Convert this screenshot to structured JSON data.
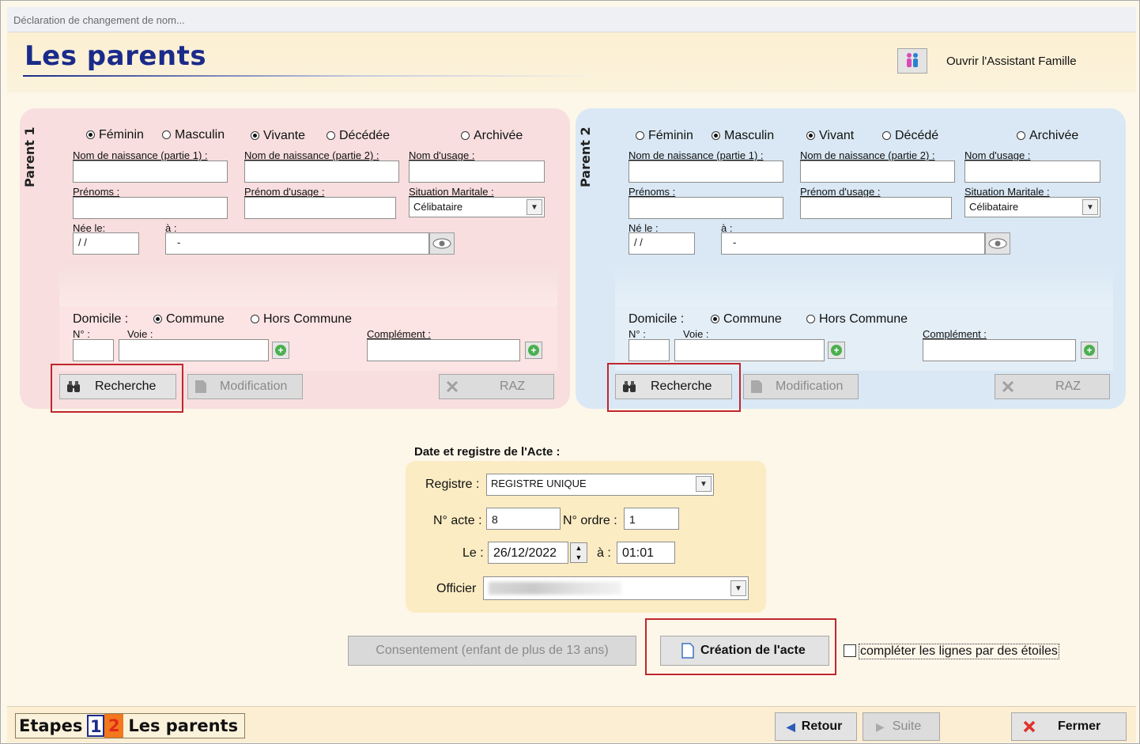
{
  "window": {
    "title": "Déclaration de changement de nom..."
  },
  "header": {
    "title": "Les parents",
    "assistant_label": "Ouvrir l'Assistant Famille"
  },
  "parent1": {
    "tab": "Parent 1",
    "sex": {
      "feminin": "Féminin",
      "masculin": "Masculin",
      "selected": "Féminin"
    },
    "status": {
      "vivant": "Vivante",
      "decede": "Décédée",
      "selected": "Vivante"
    },
    "archive": "Archivée",
    "labels": {
      "nom1": "Nom de naissance (partie 1) :",
      "nom2": "Nom de naissance (partie 2) :",
      "usage": "Nom d'usage :",
      "prenoms": "Prénoms :",
      "prenom_usage": "Prénom d'usage :",
      "situation": "Situation Maritale :",
      "ne_le": "Née le:",
      "a": "à :"
    },
    "values": {
      "situation": "Célibataire",
      "date": " / /",
      "lieu": "-"
    },
    "domicile": {
      "label": "Domicile :",
      "commune": "Commune",
      "hors": "Hors Commune",
      "selected": "Commune",
      "num": "N° :",
      "voie": "Voie :",
      "complement": "Complément :"
    },
    "buttons": {
      "recherche": "Recherche",
      "modification": "Modification",
      "raz": "RAZ"
    }
  },
  "parent2": {
    "tab": "Parent 2",
    "sex": {
      "feminin": "Féminin",
      "masculin": "Masculin",
      "selected": "Masculin"
    },
    "status": {
      "vivant": "Vivant",
      "decede": "Décédé",
      "selected": "Vivant"
    },
    "archive": "Archivée",
    "labels": {
      "nom1": "Nom de naissance (partie 1) :",
      "nom2": "Nom de naissance (partie 2) :",
      "usage": "Nom d'usage :",
      "prenoms": "Prénoms :",
      "prenom_usage": "Prénom d'usage :",
      "situation": "Situation Maritale :",
      "ne_le": "Né le :",
      "a": "à :"
    },
    "values": {
      "situation": "Célibataire",
      "date": " / /",
      "lieu": "-"
    },
    "domicile": {
      "label": "Domicile :",
      "commune": "Commune",
      "hors": "Hors Commune",
      "selected": "Commune",
      "num": "N° :",
      "voie": "Voie :",
      "complement": "Complément :"
    },
    "buttons": {
      "recherche": "Recherche",
      "modification": "Modification",
      "raz": "RAZ"
    }
  },
  "acte": {
    "title": "Date et registre de l'Acte :",
    "registre_label": "Registre :",
    "registre_value": "REGISTRE UNIQUE",
    "num_acte_label": "N° acte :",
    "num_acte_value": "8",
    "num_ordre_label": "N° ordre :",
    "num_ordre_value": "1",
    "date_label": "Le :",
    "date_value": "26/12/2022",
    "heure_label": "à :",
    "heure_value": "01:01",
    "officier_label": "Officier"
  },
  "actions": {
    "consentement": "Consentement (enfant de plus de 13 ans)",
    "creation": "Création de l'acte",
    "etoiles": "compléter les lignes par des étoiles"
  },
  "footer": {
    "etapes_label": "Etapes",
    "step1": "1",
    "step2": "2",
    "current_step": "Les parents",
    "retour": "Retour",
    "suite": "Suite",
    "fermer": "Fermer"
  },
  "colors": {
    "title": "#1b2b8a",
    "parent1_bg": "#f8dede",
    "parent2_bg": "#d9e8f4",
    "highlight": "#c0262e",
    "acte_bg": "#fbecc3"
  }
}
